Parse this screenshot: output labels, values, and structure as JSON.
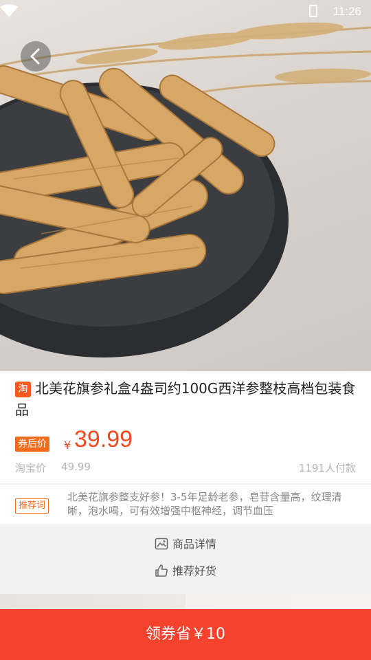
{
  "status_bar": {
    "time": "11:26"
  },
  "product": {
    "platform_badge": "淘",
    "title": "北美花旗参礼盒4盎司约100G西洋参整枝高档包装食品",
    "coupon_price_label": "券后价",
    "currency": "¥",
    "coupon_price": "39.99",
    "original_price_label": "淘宝价",
    "original_price": "49.99",
    "sales": "1191人付款"
  },
  "recommend": {
    "tag": "推荐词",
    "text": "北美花旗参整支好参！3-5年足龄老参，皂苷含量高，纹理清晰，泡水喝，可有效增强中枢神经，调节血压"
  },
  "links": {
    "details": "商品详情",
    "recommend_goods": "推荐好货"
  },
  "cta": {
    "label": "领券省￥10"
  },
  "colors": {
    "accent": "#f4422c",
    "price": "#f04b1f",
    "tag": "#f36b1c"
  }
}
